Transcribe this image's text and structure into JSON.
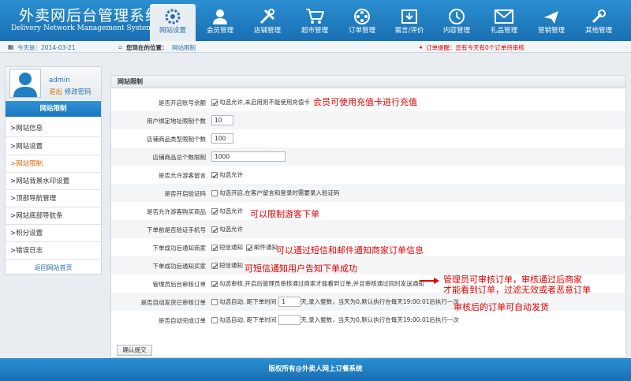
{
  "header": {
    "title": "外卖网后台管理系统",
    "subtitle": "Delivery Network Management System",
    "nav": [
      {
        "label": "网站设置",
        "icon": "settings-icon",
        "active": true
      },
      {
        "label": "会员管理",
        "icon": "user-icon"
      },
      {
        "label": "店铺管理",
        "icon": "tools-icon"
      },
      {
        "label": "超市管理",
        "icon": "cart-icon"
      },
      {
        "label": "订单管理",
        "icon": "film-icon"
      },
      {
        "label": "需言/评价",
        "icon": "download-icon"
      },
      {
        "label": "内容管理",
        "icon": "clock-icon"
      },
      {
        "label": "礼品管理",
        "icon": "mail-icon"
      },
      {
        "label": "营销管理",
        "icon": "plane-icon"
      },
      {
        "label": "其他管理",
        "icon": "wrench-icon"
      }
    ]
  },
  "infobar": {
    "today": "今天是：2014-03-21",
    "location": "您现在的位置：",
    "location_page": "网站限制",
    "order_alert": "订单提醒：您有今天有0个订单待审核"
  },
  "sidebar": {
    "username": "admin",
    "logout": "退出",
    "change_password": "修改密码",
    "section_title": "网站限制",
    "items": [
      {
        "label": ">网站信息"
      },
      {
        "label": ">网站设置"
      },
      {
        "label": ">网站限制",
        "active": true
      },
      {
        "label": ">网站背景水印设置"
      },
      {
        "label": ">顶部导航管理"
      },
      {
        "label": ">网站底部导航条"
      },
      {
        "label": ">积分设置"
      },
      {
        "label": ">错误日志"
      }
    ],
    "home_link": "返回网站首页"
  },
  "main": {
    "heading": "网站限制",
    "rows": {
      "recharge": {
        "label": "是否开启账号余额",
        "option": "勾选允许,未启用则不能使用充值卡"
      },
      "addr_limit": {
        "label": "用户绑定地址限制个数",
        "value": "10"
      },
      "shop_type_limit": {
        "label": "店铺商品类型限制个数",
        "value": "100"
      },
      "shop_goods_limit": {
        "label": "店铺商品总个数限制",
        "value": "1000"
      },
      "guest_msg": {
        "label": "是否允许游客留言",
        "option": "勾选允许"
      },
      "captcha": {
        "label": "是否开启验证码",
        "option": "勾选开启,在客户留言和登录时需要录入验证码"
      },
      "guest_buy": {
        "label": "是否允许游客购买商品",
        "option": "勾选允许"
      },
      "phone_verify": {
        "label": "下单前是否验证手机号",
        "option": "勾选允许"
      },
      "notify_shop": {
        "label": "下单成功后通知商家",
        "sms": "短信通知",
        "email": "邮件通知"
      },
      "notify_buyer": {
        "label": "下单成功后通知买家",
        "sms": "短信通知"
      },
      "admin_review": {
        "label": "管理员后台审核订单",
        "option": "勾选审核,开启后管理员审核通过商家才能看到订单,并且审核通过同时发送通知"
      },
      "auto_ship": {
        "label": "是否自动发货已审核订单",
        "option": "勾选自动, 距下单时间",
        "value": "1",
        "suffix": "天,录入整数，当天为0,默认执行在每天19:00:01后执行一次"
      },
      "auto_complete": {
        "label": "是否自动完成订单",
        "option": "勾选自动, 距下单时间",
        "value": "",
        "suffix": "天,录入整数，当天为0,默认执行在每天19:00:01后执行一次"
      }
    },
    "confirm_button": "确认提交"
  },
  "notes": {
    "recharge": "会员可使用充值卡进行充值",
    "guest_buy": "可以限制游客下单",
    "notify_shop": "可以通过短信和邮件通知商家订单信息",
    "notify_buyer": "可短信通知用户告知下单成功",
    "admin_review_1": "管理员可审核订单，审核通过后商家",
    "admin_review_2": "才能看到订单，过滤无效或者恶意订单",
    "auto_ship": "审核后的订单可自动发货"
  },
  "footer": {
    "text": "版权所有@外卖人网上订餐系统"
  },
  "colors": {
    "brand": "#1f7fc4",
    "note": "#e10000",
    "active_link": "#e06a00"
  }
}
